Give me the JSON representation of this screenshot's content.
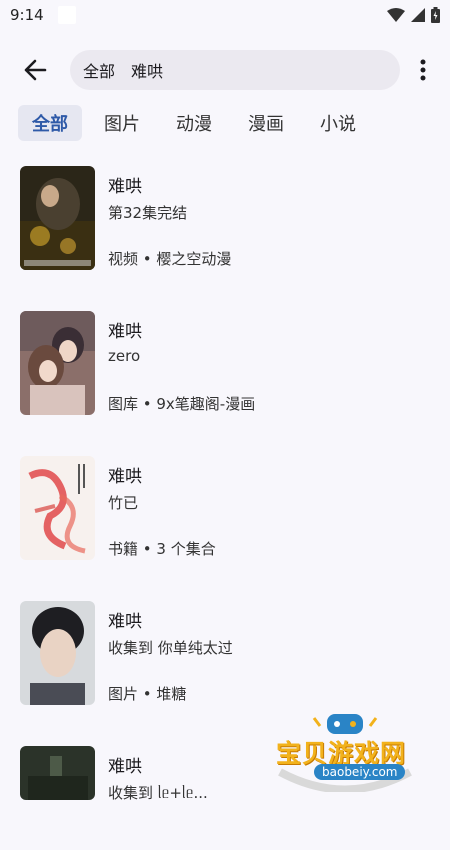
{
  "status_bar": {
    "time": "9:14"
  },
  "search": {
    "scope": "全部",
    "query": "难哄"
  },
  "tabs": [
    {
      "label": "全部",
      "active": true
    },
    {
      "label": "图片",
      "active": false
    },
    {
      "label": "动漫",
      "active": false
    },
    {
      "label": "漫画",
      "active": false
    },
    {
      "label": "小说",
      "active": false
    }
  ],
  "results": [
    {
      "title": "难哄",
      "subtitle": "第32集完结",
      "meta": "视频 • 樱之空动漫"
    },
    {
      "title": "难哄",
      "subtitle": "zero",
      "meta": "图库 • 9x笔趣阁-漫画"
    },
    {
      "title": "难哄",
      "subtitle": "竹已",
      "meta": "书籍 • 3 个集合"
    },
    {
      "title": "难哄",
      "subtitle": "收集到 你单纯太过",
      "meta": "图片 • 堆糖"
    },
    {
      "title": "难哄",
      "subtitle": "收集到 ᥣᥱ+ᥣᥱ..."
    }
  ],
  "watermark": {
    "name": "宝贝游戏网",
    "url": "baobeiy.com"
  },
  "colors": {
    "accent": "#2f5aa8",
    "background": "#f8f7fc",
    "pill": "#ebe9f0"
  }
}
